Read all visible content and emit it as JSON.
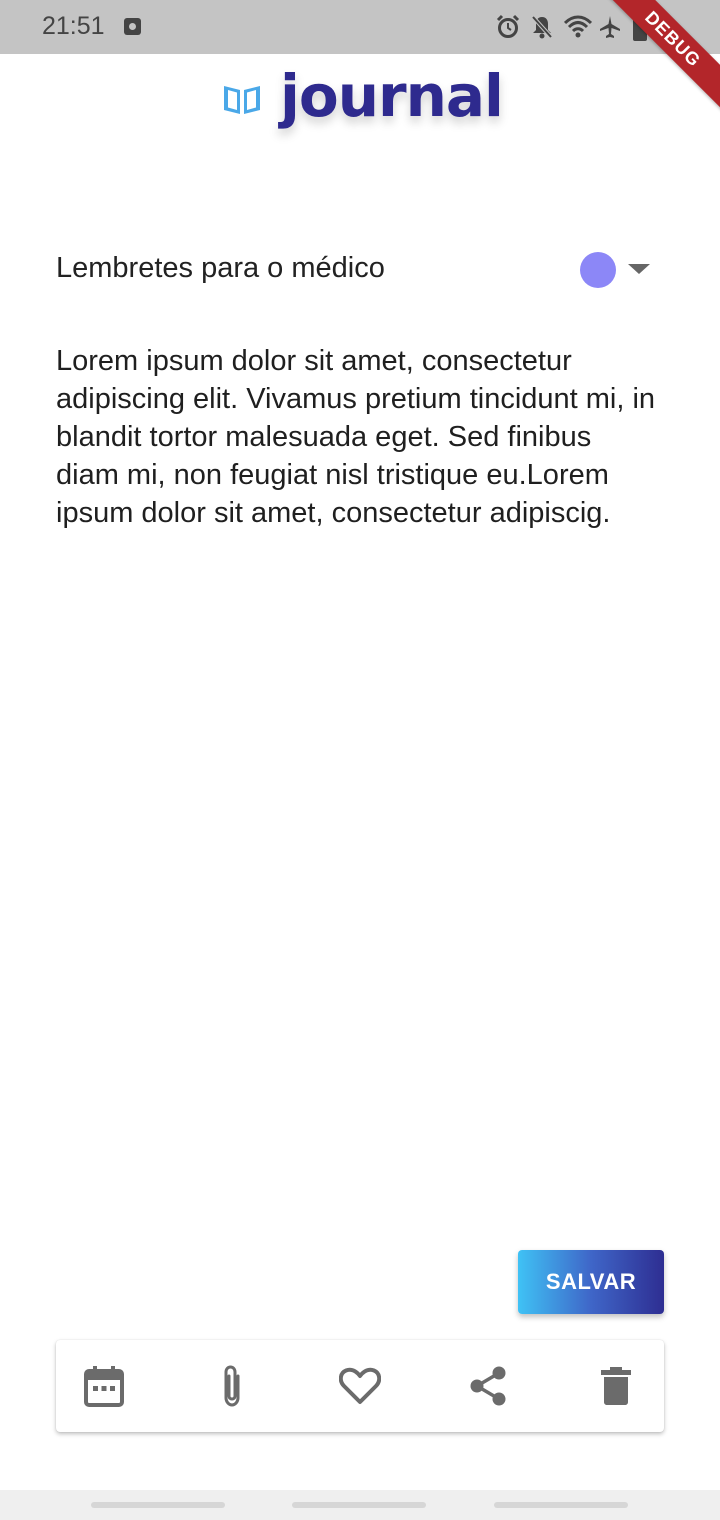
{
  "status_bar": {
    "time": "21:51",
    "icons": [
      "app-notification-icon",
      "alarm-icon",
      "mute-icon",
      "wifi-icon",
      "airplane-icon",
      "battery-charging-icon"
    ]
  },
  "debug_banner": {
    "label": "DEBUG",
    "color": "#b3262a"
  },
  "app": {
    "logo_text": "journal",
    "logo_icon": "open-book-icon",
    "brand_color": "#2e2a8e"
  },
  "note": {
    "title": "Lembretes para o médico",
    "selected_color": "#8c87f7",
    "body": "Lorem ipsum dolor sit amet, consectetur adipiscing elit. Vivamus pretium tincidunt mi, in blandit tortor malesuada eget. Sed finibus diam mi, non feugiat nisl tristique eu.Lorem ipsum dolor sit amet, consectetur adipiscig."
  },
  "actions": {
    "save_label": "SALVAR",
    "save_gradient": [
      "#3fc2f5",
      "#2e2e92"
    ]
  },
  "toolbar": {
    "icon_color": "#6b6b6b",
    "items": [
      "calendar-icon",
      "attachment-icon",
      "favorite-icon",
      "share-icon",
      "delete-icon"
    ]
  }
}
